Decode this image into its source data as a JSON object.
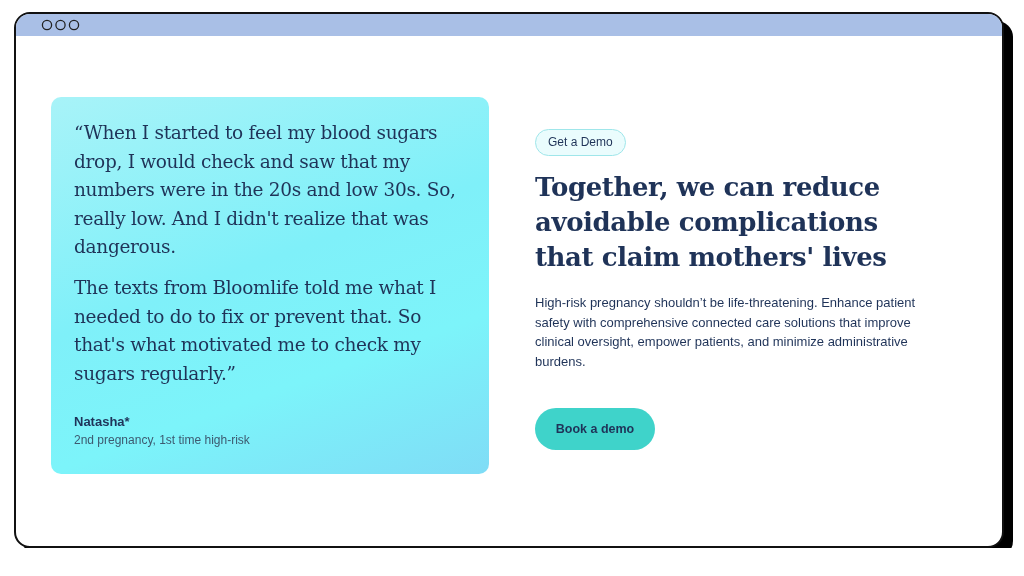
{
  "testimonial": {
    "paragraphs": [
      "“When I started to feel my blood sugars drop, I would check and saw that my numbers were in the 20s and low 30s. So, really low. And I didn't realize that was dangerous.",
      "The texts from Bloomlife told me what I needed to do to fix or prevent that. So that's what motivated me to check my sugars regularly.”"
    ],
    "author": "Natasha*",
    "author_detail": "2nd pregnancy, 1st time high-risk"
  },
  "badge": "Get a Demo",
  "heading": "Together, we can reduce avoidable complications that claim mothers' lives",
  "description": "High-risk pregnancy shouldn’t be life-threatening. Enhance patient safety with comprehensive connected care solutions that improve clinical oversight, empower patients, and minimize administrative burdens.",
  "cta_button": "Book a demo"
}
